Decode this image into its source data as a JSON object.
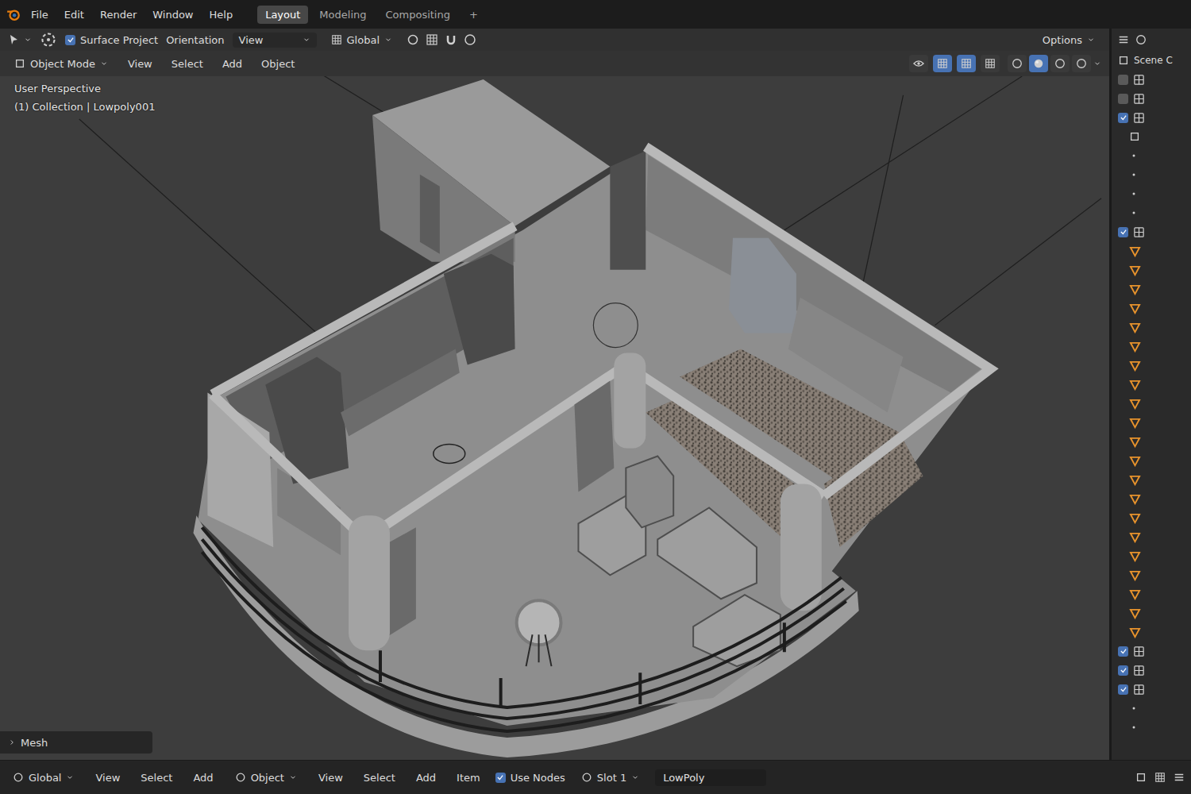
{
  "window": {
    "title": "Blender"
  },
  "menu": [
    {
      "label": "File"
    },
    {
      "label": "Edit"
    },
    {
      "label": "Render"
    },
    {
      "label": "Window"
    },
    {
      "label": "Help"
    }
  ],
  "workspace_tabs": [
    {
      "label": "Layout",
      "selected": true
    },
    {
      "label": "Modeling",
      "selected": false
    },
    {
      "label": "Compositing",
      "selected": false
    }
  ],
  "add_tab": "+",
  "tool_settings": {
    "snap_checked": true,
    "snap_label": "Surface Project",
    "orientation": "Orientation",
    "view": "View",
    "transform": "Global",
    "options": "Options"
  },
  "header": {
    "mode": "Object Mode",
    "menus": [
      "View",
      "Select",
      "Add",
      "Object"
    ],
    "toggles": [
      {
        "selected": false
      },
      {
        "selected": true
      },
      {
        "selected": true
      },
      {
        "selected": false
      }
    ],
    "shading": [
      {
        "selected": false
      },
      {
        "selected": true
      },
      {
        "selected": false
      },
      {
        "selected": false
      }
    ]
  },
  "viewport": {
    "title": "User Perspective",
    "subtitle": "(1) Collection | Lowpoly001"
  },
  "last_operator": {
    "label": "Mesh",
    "expanded": false
  },
  "outliner": {
    "title": "Scene C",
    "items": [
      {
        "kind": "collection",
        "checked": false,
        "depth": 0
      },
      {
        "kind": "collection",
        "checked": false,
        "depth": 0
      },
      {
        "kind": "collection",
        "checked": true,
        "depth": 0
      },
      {
        "kind": "mesh",
        "checked": false,
        "depth": 1
      },
      {
        "kind": "empty",
        "checked": false,
        "depth": 1
      },
      {
        "kind": "empty",
        "checked": false,
        "depth": 1
      },
      {
        "kind": "empty",
        "checked": false,
        "depth": 1
      },
      {
        "kind": "empty",
        "checked": false,
        "depth": 1
      },
      {
        "kind": "collection",
        "checked": true,
        "depth": 0
      },
      {
        "kind": "object",
        "checked": false,
        "depth": 1
      },
      {
        "kind": "object",
        "checked": false,
        "depth": 1
      },
      {
        "kind": "object",
        "checked": false,
        "depth": 1
      },
      {
        "kind": "object",
        "checked": false,
        "depth": 1
      },
      {
        "kind": "object",
        "checked": false,
        "depth": 1
      },
      {
        "kind": "object",
        "checked": false,
        "depth": 1
      },
      {
        "kind": "object",
        "checked": false,
        "depth": 1
      },
      {
        "kind": "object",
        "checked": false,
        "depth": 1
      },
      {
        "kind": "object",
        "checked": false,
        "depth": 1
      },
      {
        "kind": "object",
        "checked": false,
        "depth": 1
      },
      {
        "kind": "object",
        "checked": false,
        "depth": 1
      },
      {
        "kind": "object",
        "checked": false,
        "depth": 1
      },
      {
        "kind": "object",
        "checked": false,
        "depth": 1
      },
      {
        "kind": "object",
        "checked": false,
        "depth": 1
      },
      {
        "kind": "object",
        "checked": false,
        "depth": 1
      },
      {
        "kind": "object",
        "checked": false,
        "depth": 1
      },
      {
        "kind": "object",
        "checked": false,
        "depth": 1
      },
      {
        "kind": "object",
        "checked": false,
        "depth": 1
      },
      {
        "kind": "object",
        "checked": false,
        "depth": 1
      },
      {
        "kind": "object",
        "checked": false,
        "depth": 1
      },
      {
        "kind": "object",
        "checked": false,
        "depth": 1
      },
      {
        "kind": "collection",
        "checked": true,
        "depth": 0
      },
      {
        "kind": "collection",
        "checked": true,
        "depth": 0
      },
      {
        "kind": "collection",
        "checked": true,
        "depth": 0
      },
      {
        "kind": "empty",
        "checked": false,
        "depth": 1
      },
      {
        "kind": "empty",
        "checked": false,
        "depth": 1
      }
    ]
  },
  "status_bar": {
    "items": [
      {
        "label": "Global",
        "kind": "dropdown"
      },
      {
        "label": "View",
        "kind": "menu"
      },
      {
        "label": "Select",
        "kind": "menu"
      },
      {
        "label": "Add",
        "kind": "menu"
      },
      {
        "label": "Object",
        "kind": "dropdown"
      },
      {
        "label": "View",
        "kind": "menu"
      },
      {
        "label": "Select",
        "kind": "menu"
      },
      {
        "label": "Add",
        "kind": "menu"
      },
      {
        "label": "Item",
        "kind": "menu"
      },
      {
        "label": "Use Nodes",
        "kind": "checkbox"
      },
      {
        "label": "Slot 1",
        "kind": "dropdown"
      },
      {
        "label": "LowPoly",
        "kind": "field"
      }
    ]
  }
}
